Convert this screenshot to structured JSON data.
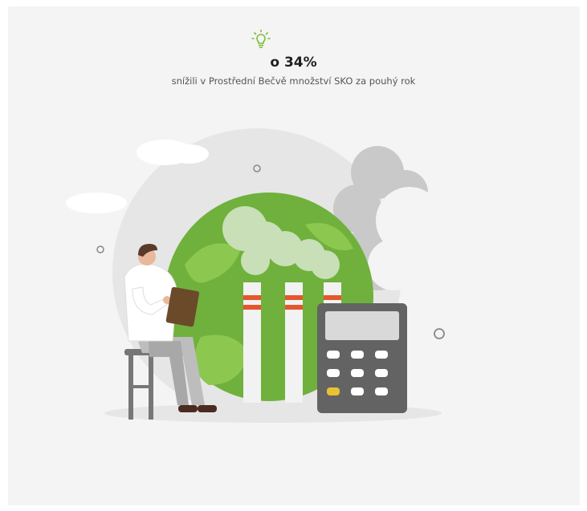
{
  "highlight": {
    "icon": "lightbulb-icon",
    "stat": "o 34%",
    "caption": "snížili v Prostřední Bečvě množství SKO za pouhý rok"
  },
  "colors": {
    "accent": "#7bbd3a",
    "globe": "#6fb13c",
    "stripe": "#e4572e"
  },
  "calculator": {
    "display": ""
  }
}
